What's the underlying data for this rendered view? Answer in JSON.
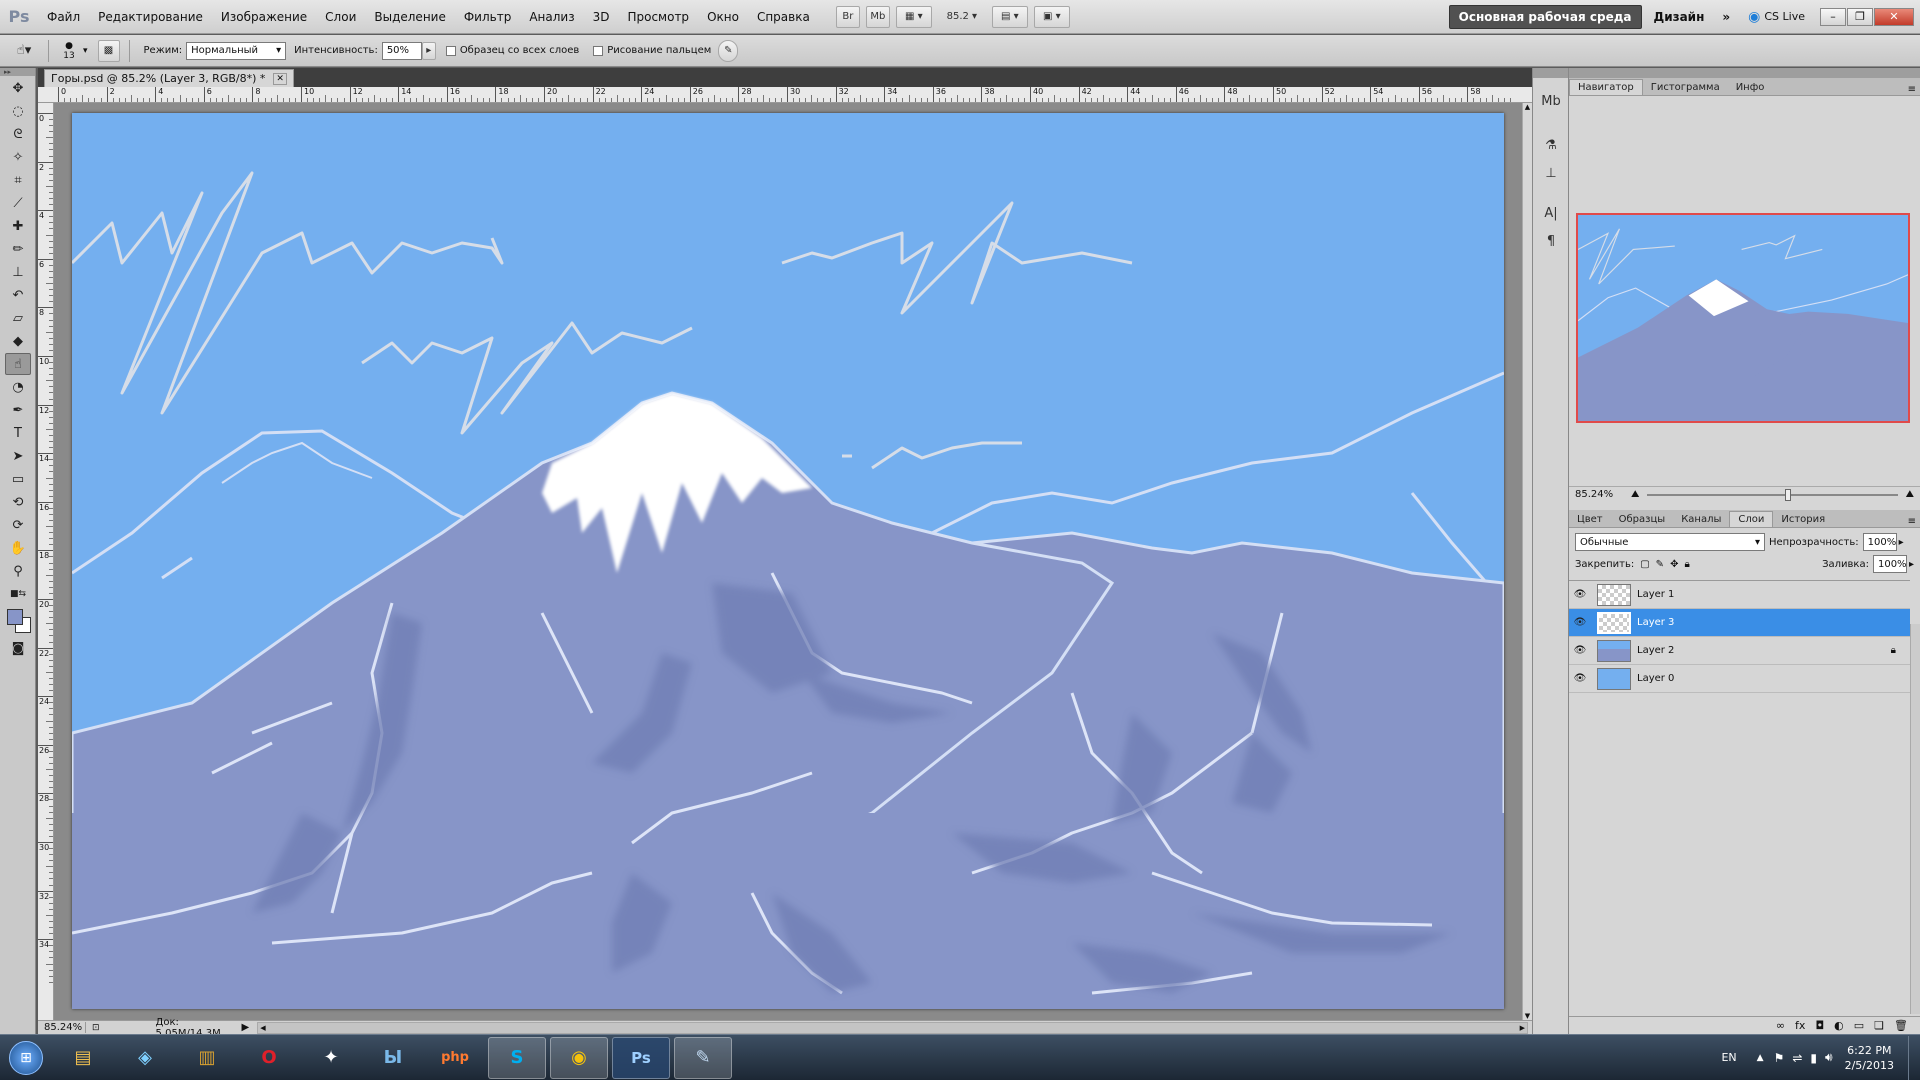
{
  "app": {
    "logo": "Ps"
  },
  "menu": [
    "Файл",
    "Редактирование",
    "Изображение",
    "Слои",
    "Выделение",
    "Фильтр",
    "Анализ",
    "3D",
    "Просмотр",
    "Окно",
    "Справка"
  ],
  "menubar": {
    "bridge": "Br",
    "minibridge": "Mb",
    "zoom": "85.2",
    "workspace": "Основная рабочая среда",
    "design": "Дизайн",
    "more": "»",
    "cslive": "CS Live"
  },
  "options": {
    "brush_size": "13",
    "mode_label": "Режим:",
    "mode_value": "Нормальный",
    "intensity_label": "Интенсивность:",
    "intensity_value": "50%",
    "sample_all_layers": "Образец со всех слоев",
    "finger_painting": "Рисование пальцем"
  },
  "document": {
    "tab_title": "Горы.psd @ 85.2% (Layer 3, RGB/8*) *",
    "ruler_top": [
      "0",
      "2",
      "4",
      "6",
      "8",
      "10",
      "12",
      "14",
      "16",
      "18",
      "20",
      "22",
      "24",
      "26",
      "28",
      "30",
      "32",
      "34",
      "36",
      "38",
      "40",
      "42",
      "44",
      "46",
      "48",
      "50",
      "52",
      "54",
      "56",
      "58"
    ],
    "ruler_left": [
      "0",
      "2",
      "4",
      "6",
      "8",
      "10",
      "12",
      "14",
      "16",
      "18",
      "20",
      "22",
      "24",
      "26",
      "28",
      "30",
      "32",
      "34"
    ],
    "status_zoom": "85.24%",
    "status_doc": "Док: 5.05M/14.3M"
  },
  "navigator": {
    "tabs": [
      "Навигатор",
      "Гистограмма",
      "Инфо"
    ],
    "active_tab": "Навигатор",
    "zoom": "85.24%"
  },
  "layers_panel": {
    "tabs": [
      "Цвет",
      "Образцы",
      "Каналы",
      "Слои",
      "История"
    ],
    "active_tab": "Слои",
    "blend_mode": "Обычные",
    "opacity_label": "Непрозрачность:",
    "opacity_value": "100%",
    "lock_label": "Закрепить:",
    "fill_label": "Заливка:",
    "fill_value": "100%",
    "layers": [
      {
        "name": "Layer 1",
        "selected": false,
        "thumb": "transparent",
        "locked": false
      },
      {
        "name": "Layer 3",
        "selected": true,
        "thumb": "transparent",
        "locked": false
      },
      {
        "name": "Layer 2",
        "selected": false,
        "thumb": "mountains",
        "locked": true
      },
      {
        "name": "Layer 0",
        "selected": false,
        "thumb": "sky",
        "locked": false
      }
    ]
  },
  "taskbar": {
    "apps": [
      "windows-explorer",
      "paint-program",
      "winrar",
      "opera",
      "foobar",
      "dreamweaver",
      "php-designer",
      "skype",
      "chrome",
      "photoshop",
      "paint-tool"
    ],
    "lang": "EN",
    "time": "6:22 PM",
    "date": "2/5/2013"
  },
  "colors": {
    "sky": "#74afef",
    "mountain": "#8795c8",
    "snow": "#ffffff",
    "selected": "#3a8ee6",
    "workspace_button": "#515151"
  }
}
